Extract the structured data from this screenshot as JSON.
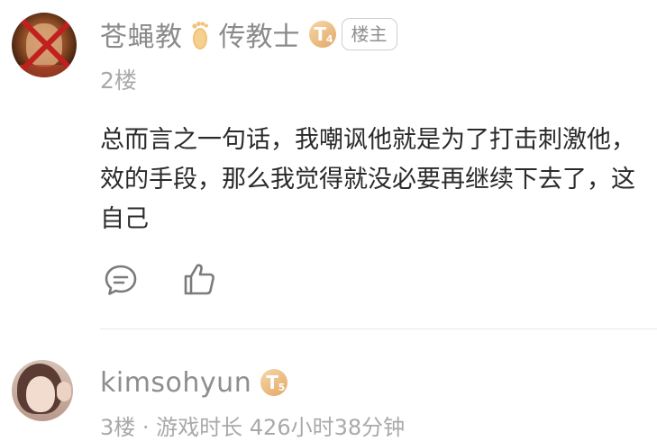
{
  "post1": {
    "username": "苍蝇教",
    "title": "传教士",
    "level": {
      "letter": "T",
      "number": "4"
    },
    "owner_tag": "楼主",
    "floor": "2楼",
    "content_lines": [
      "总而言之一句话，我嘲讽他就是为了打击刺激他，",
      "效的手段，那么我觉得就没必要再继续下去了，这",
      "自己"
    ],
    "icons": {
      "reply": "reply-icon",
      "like": "like-icon",
      "title_badge": "foot-icon"
    }
  },
  "post2": {
    "username": "kimsohyun",
    "level": {
      "letter": "T",
      "number": "5"
    },
    "meta": "3楼 · 游戏时长 426小时38分钟"
  },
  "colors": {
    "username_gray": "#8b8b8b",
    "meta_gray": "#a9a9a9",
    "body_text": "#2a2a2a",
    "badge_gold": "#e2a865",
    "divider": "#e7e7e7"
  }
}
